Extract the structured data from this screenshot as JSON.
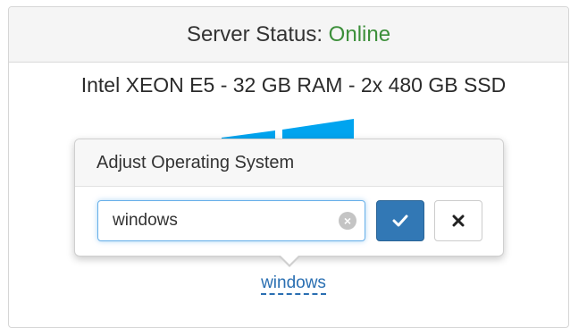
{
  "header": {
    "status_label": "Server Status:",
    "status_value": "Online",
    "status_color": "#3c8f3a"
  },
  "server": {
    "spec": "Intel XEON E5 - 32 GB RAM - 2x 480 GB SSD",
    "os_icon": "windows-logo-icon"
  },
  "popover": {
    "title": "Adjust Operating System",
    "input_value": "windows",
    "clear_icon": "clear-circle-icon",
    "submit_icon": "checkmark-icon",
    "cancel_icon": "close-x-icon"
  },
  "os_link": {
    "label": "windows"
  },
  "colors": {
    "accent": "#3278b5",
    "link": "#2a6fb2",
    "logo": "#00a4ef"
  }
}
